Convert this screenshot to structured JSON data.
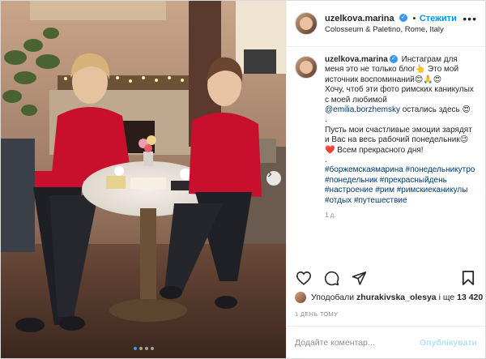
{
  "header": {
    "username": "uzelkova.marina",
    "follow_label": "Стежити",
    "separator": "•",
    "location": "Colosseum & Paletino, Rome, Italy",
    "more_icon": "more-horizontal-icon"
  },
  "caption": {
    "username": "uzelkova.marina",
    "line1": "Инстаграм для меня это не только блог👆 Это мой источник воспоминаний😊🙏😍",
    "line2": "Хочу, чтоб эти фото римских каникулых с моей любимой",
    "mention": "@emilia.borzhemsky",
    "line2_end": " остались здесь 😍",
    "dot1": ".",
    "line3": "Пусть мои счастливые эмоции зарядят и Вас на весь рабочий понедельник😉❤️ Всем прекрасного дня!",
    "dot2": ".",
    "hashtags": "#боржемскаямарина #понедельникутро #понедельник #прекрасныйдень #настроение #рим #римскиеканикулы #отдых #путешествие",
    "time": "1 д."
  },
  "actions": {
    "like_icon": "heart-icon",
    "comment_icon": "comment-icon",
    "share_icon": "share-icon",
    "save_icon": "bookmark-icon"
  },
  "likes": {
    "prefix": "Уподобали",
    "user": "zhurakivska_olesya",
    "middle": "і ще",
    "count": "13 420"
  },
  "date": "1 ДЕНЬ ТОМУ",
  "comment": {
    "placeholder": "Додайте коментар...",
    "publish_label": "Опублікувати"
  },
  "carousel": {
    "slides": 4,
    "active": 0
  },
  "colors": {
    "accent": "#0095f6",
    "publish_disabled": "#b2dffc",
    "sweater": "#c8102e"
  }
}
